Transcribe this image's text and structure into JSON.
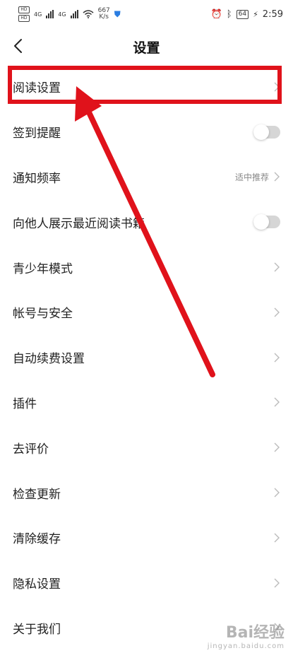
{
  "status_bar": {
    "sim1": "HD",
    "sim2": "HD",
    "net1": "4G",
    "net2": "4G",
    "speed_value": "667",
    "speed_unit": "K/s",
    "battery": "64",
    "time": "2:59"
  },
  "header": {
    "title": "设置"
  },
  "settings": [
    {
      "label": "阅读设置",
      "control": "chevron"
    },
    {
      "label": "签到提醒",
      "control": "toggle",
      "on": false
    },
    {
      "label": "通知频率",
      "control": "chevron",
      "value": "适中推荐"
    },
    {
      "label": "向他人展示最近阅读书籍",
      "control": "toggle",
      "on": false
    },
    {
      "label": "青少年模式",
      "control": "chevron"
    },
    {
      "label": "帐号与安全",
      "control": "chevron"
    },
    {
      "label": "自动续费设置",
      "control": "chevron"
    },
    {
      "label": "插件",
      "control": "chevron"
    },
    {
      "label": "去评价",
      "control": "chevron"
    },
    {
      "label": "检查更新",
      "control": "chevron"
    },
    {
      "label": "清除缓存",
      "control": "chevron"
    },
    {
      "label": "隐私设置",
      "control": "chevron"
    },
    {
      "label": "关于我们",
      "control": "chevron"
    }
  ],
  "colors": {
    "annotation_red": "#e0121b",
    "chevron": "#bbbbbb",
    "toggle_track": "#d6d6d6"
  },
  "watermark": {
    "brand": "Bai经验",
    "url": "jingyan.baidu.com"
  }
}
